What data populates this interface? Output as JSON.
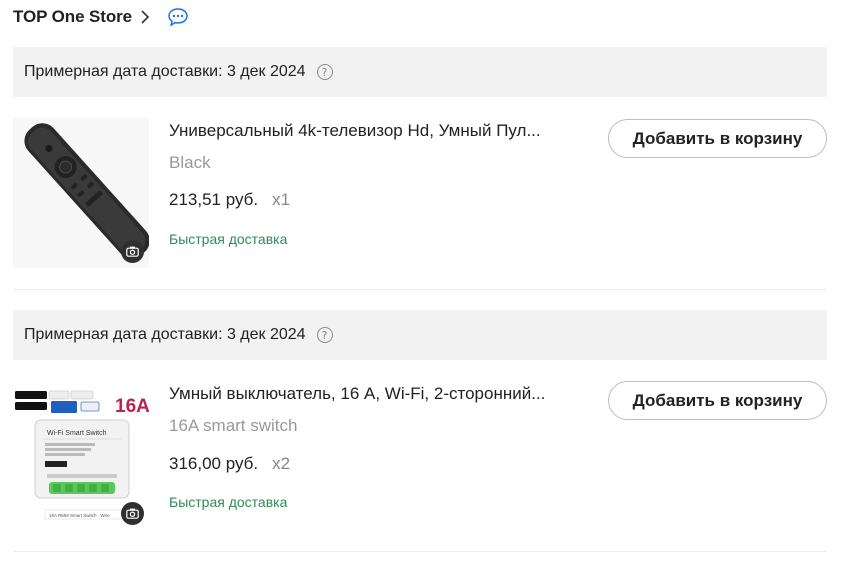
{
  "store": {
    "name": "TOP One Store"
  },
  "items": [
    {
      "delivery_label": "Примерная дата доставки: 3 дек 2024",
      "title": "Универсальный 4k-телевизор Hd, Умный Пул...",
      "variant": "Black",
      "price": "213,51 руб.",
      "qty": "x1",
      "shipping": "Быстрая доставка",
      "button": "Добавить в корзину",
      "image_icon": "tv-remote-image"
    },
    {
      "delivery_label": "Примерная дата доставки: 3 дек 2024",
      "title": "Умный выключатель, 16 А, Wi-Fi, 2-сторонний...",
      "variant": "16A smart switch",
      "price": "316,00 руб.",
      "qty": "x2",
      "shipping": "Быстрая доставка",
      "button": "Добавить в корзину",
      "image_icon": "smart-switch-image",
      "image_text": {
        "badge": "16A",
        "device_title": "Wi-Fi Smart Switch",
        "caption": "16A RMM Smart Switch · Wire"
      }
    }
  ],
  "colors": {
    "shipping": "#2e8b57",
    "chat_icon": "#1a73e8",
    "bar_bg": "#f2f2f2"
  }
}
